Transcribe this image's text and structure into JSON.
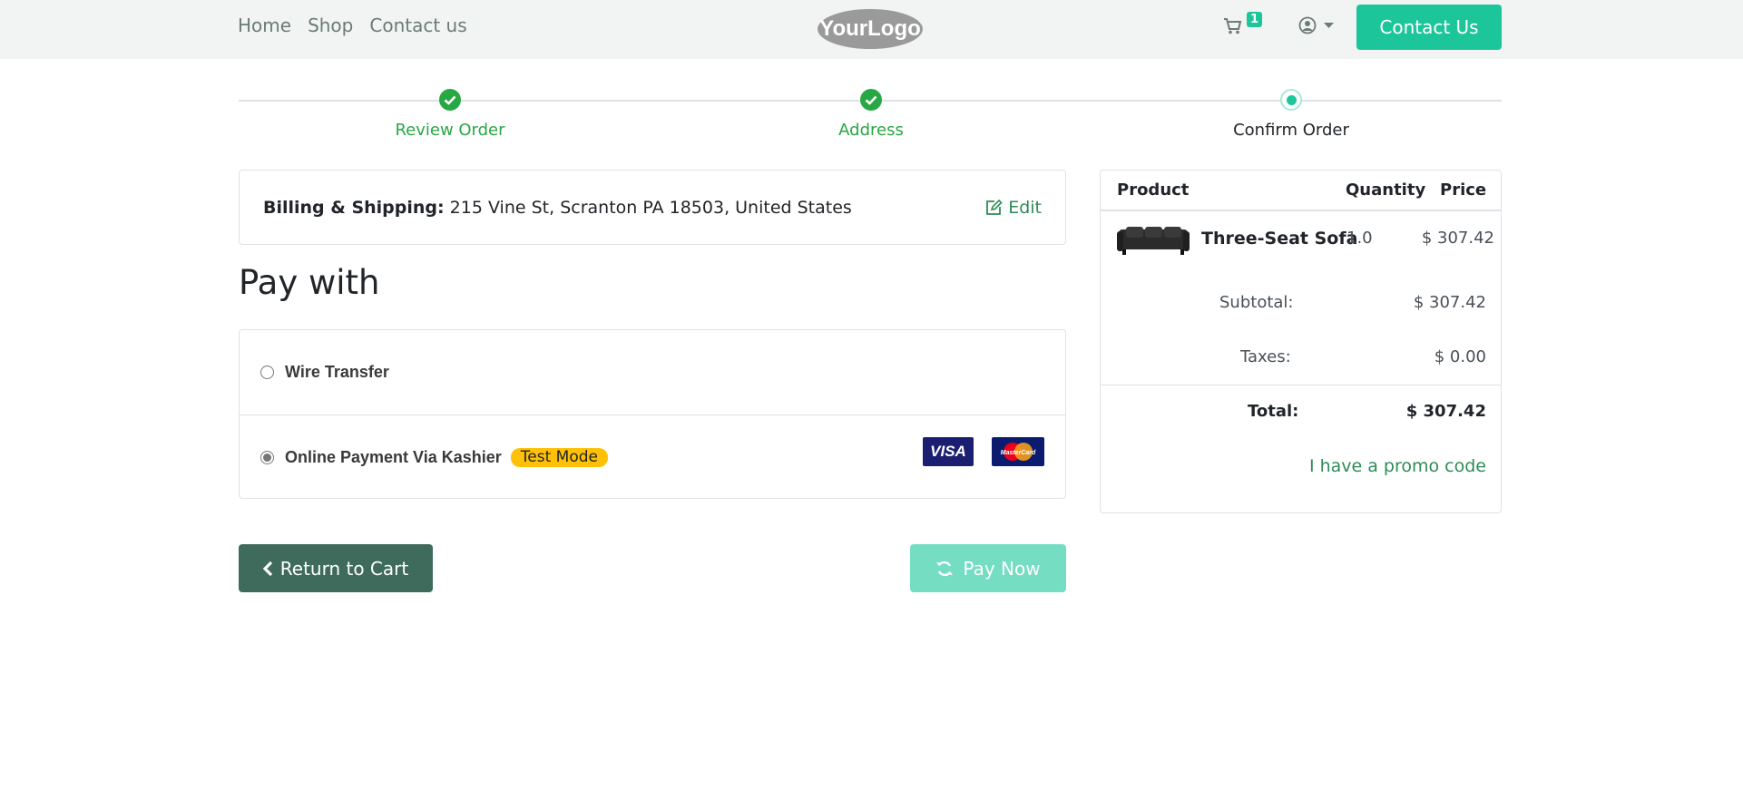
{
  "header": {
    "nav": [
      {
        "label": "Home"
      },
      {
        "label": "Shop"
      },
      {
        "label": "Contact us"
      }
    ],
    "logo_text": "YourLogo",
    "cart_count": "1",
    "contact_button": "Contact Us",
    "icons": {
      "cart": "shopping-cart-icon",
      "user": "user-circle-icon",
      "caret": "caret-down-icon"
    }
  },
  "progress": {
    "steps": [
      {
        "label": "Review Order",
        "state": "done"
      },
      {
        "label": "Address",
        "state": "done"
      },
      {
        "label": "Confirm Order",
        "state": "current"
      }
    ],
    "colors": {
      "done": "#28a745",
      "current": "#1dc59a"
    }
  },
  "billing": {
    "label": "Billing & Shipping:",
    "address": "215 Vine St, Scranton PA 18503, United States",
    "edit_label": "Edit"
  },
  "payment": {
    "title": "Pay with",
    "options": [
      {
        "label": "Wire Transfer",
        "selected": false
      },
      {
        "label": "Online Payment Via Kashier",
        "badge": "Test Mode",
        "selected": true
      }
    ],
    "card_visa": "VISA",
    "card_mastercard": "MasterCard"
  },
  "actions": {
    "return_label": "Return to Cart",
    "pay_label": "Pay Now"
  },
  "summary": {
    "headers": {
      "product": "Product",
      "quantity": "Quantity",
      "price": "Price"
    },
    "items": [
      {
        "name": "Three-Seat Sofa",
        "quantity": "1.0",
        "price": "$ 307.42"
      }
    ],
    "subtotal_label": "Subtotal:",
    "subtotal": "$ 307.42",
    "taxes_label": "Taxes:",
    "taxes": "$ 0.00",
    "total_label": "Total:",
    "total": "$ 307.42",
    "promo_label": "I have a promo code"
  },
  "colors": {
    "accent": "#1dc59a",
    "link": "#2e8b57",
    "return_button": "#3e6b5b",
    "badge": "#ffc107"
  }
}
